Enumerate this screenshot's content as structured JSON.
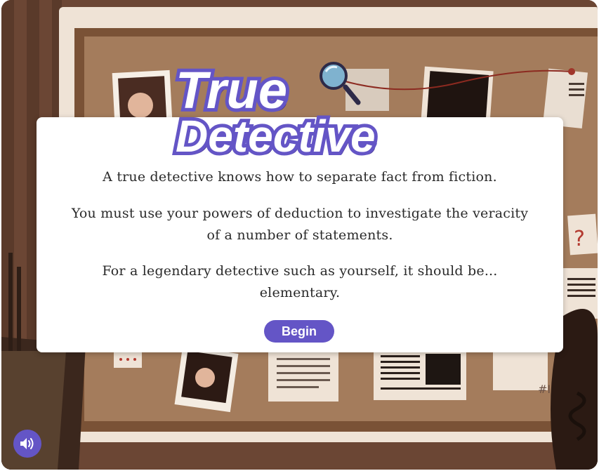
{
  "logo": {
    "line1": "True",
    "line2": "Detective"
  },
  "card": {
    "paragraph1": "A true detective knows how to separate fact from fiction.",
    "paragraph2": "You must use your powers of deduction to investigate the veracity of a number of statements.",
    "paragraph3": "For a legendary detective such as yourself, it should be... elementary."
  },
  "begin_label": "Begin",
  "sound_icon": "speaker-volume-icon",
  "colors": {
    "accent": "#6455c6",
    "board": "#a47c5c",
    "frame": "#4d3324"
  }
}
